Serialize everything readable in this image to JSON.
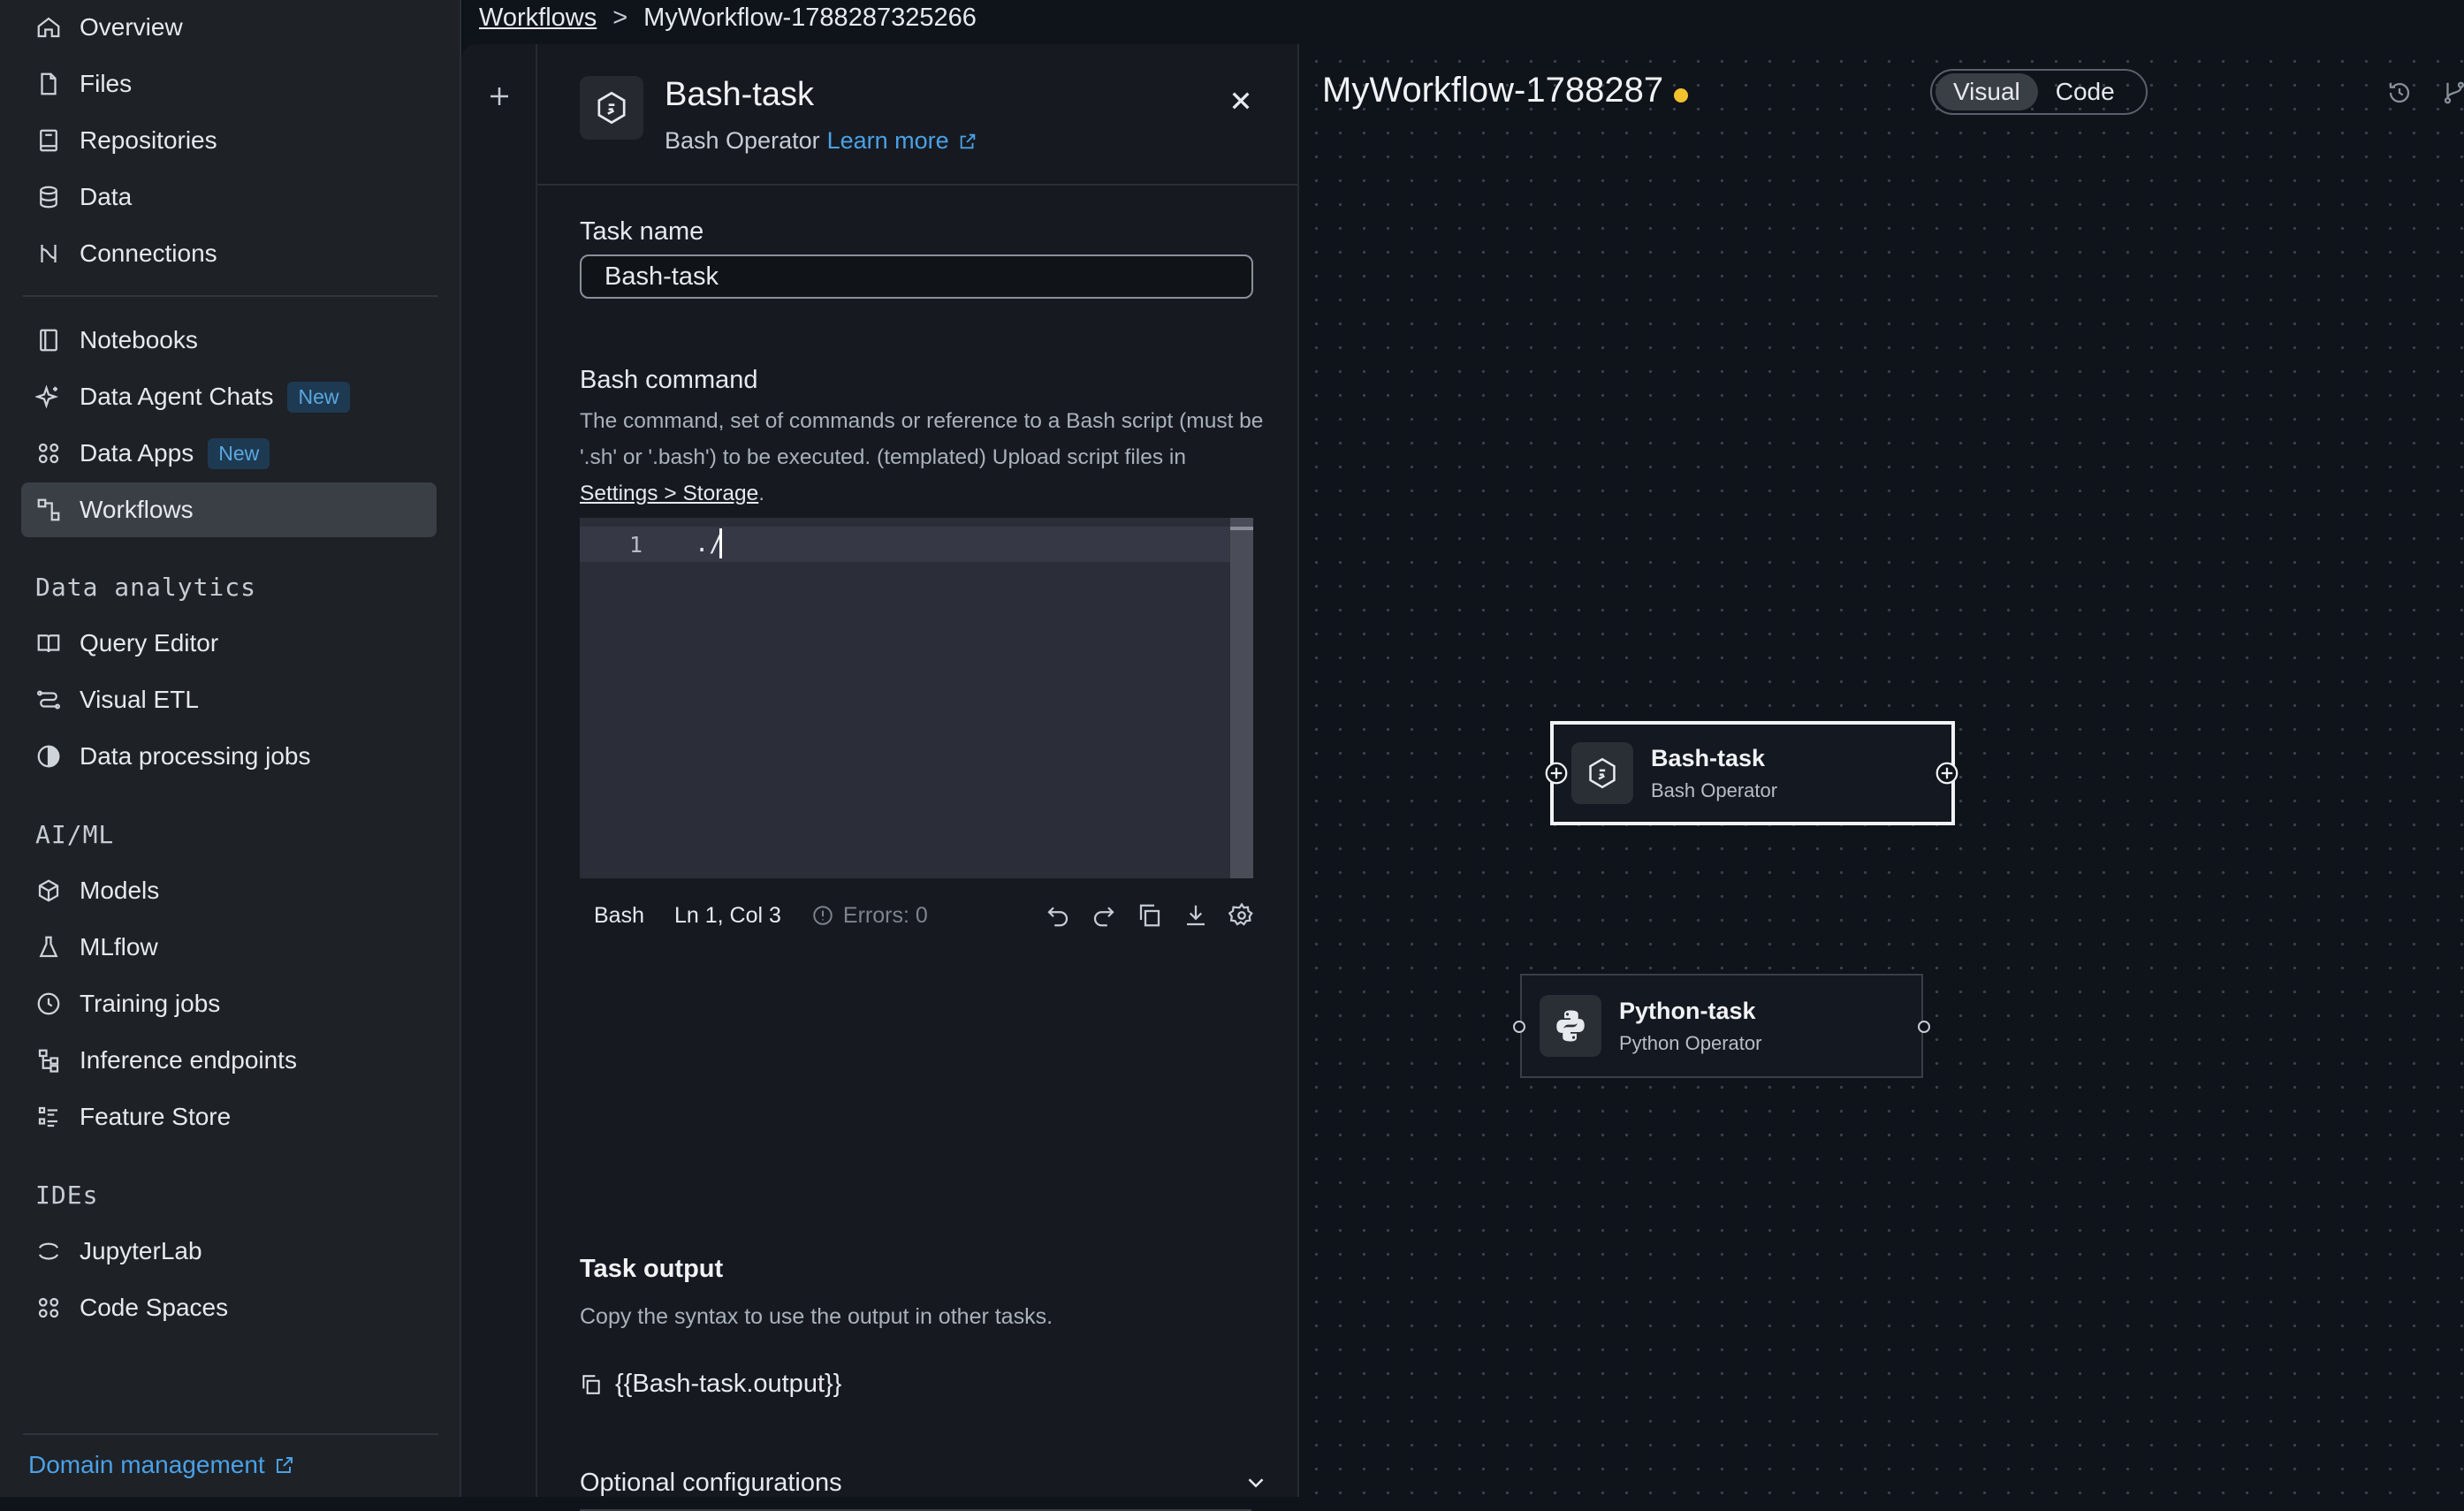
{
  "sidebar": {
    "items": [
      {
        "label": "Overview",
        "icon": "home-icon"
      },
      {
        "label": "Files",
        "icon": "file-icon"
      },
      {
        "label": "Repositories",
        "icon": "repository-icon"
      },
      {
        "label": "Data",
        "icon": "database-icon"
      },
      {
        "label": "Connections",
        "icon": "connections-icon"
      },
      {
        "label": "Notebooks",
        "icon": "notebook-icon"
      },
      {
        "label": "Data Agent Chats",
        "icon": "sparkle-icon",
        "badge": "New"
      },
      {
        "label": "Data Apps",
        "icon": "apps-grid-icon",
        "badge": "New"
      },
      {
        "label": "Workflows",
        "icon": "workflow-icon",
        "active": true
      }
    ],
    "sections": [
      {
        "title": "Data analytics",
        "items": [
          {
            "label": "Query Editor",
            "icon": "book-icon"
          },
          {
            "label": "Visual ETL",
            "icon": "etl-icon"
          },
          {
            "label": "Data processing jobs",
            "icon": "processing-icon"
          }
        ]
      },
      {
        "title": "AI/ML",
        "items": [
          {
            "label": "Models",
            "icon": "cube-icon"
          },
          {
            "label": "MLflow",
            "icon": "flask-icon"
          },
          {
            "label": "Training jobs",
            "icon": "clock-icon"
          },
          {
            "label": "Inference endpoints",
            "icon": "endpoint-icon"
          },
          {
            "label": "Feature Store",
            "icon": "list-icon"
          }
        ]
      },
      {
        "title": "IDEs",
        "items": [
          {
            "label": "JupyterLab",
            "icon": "jupyter-icon"
          },
          {
            "label": "Code Spaces",
            "icon": "apps-grid-icon"
          }
        ]
      }
    ],
    "footer_link": "Domain management"
  },
  "breadcrumb": {
    "parent": "Workflows",
    "separator": ">",
    "current": "MyWorkflow-1788287325266"
  },
  "panel": {
    "title": "Bash-task",
    "subtitle": "Bash Operator",
    "learn_more": "Learn more",
    "task_name_label": "Task name",
    "task_name_value": "Bash-task",
    "bash_label": "Bash command",
    "bash_desc": "The command, set of commands or reference to a Bash script (must be '.sh' or '.bash') to be executed. (templated) Upload script files in",
    "settings_link": "Settings > Storage",
    "editor": {
      "line_number": "1",
      "code": "./"
    },
    "status": {
      "language": "Bash",
      "position": "Ln 1, Col 3",
      "errors": "Errors: 0"
    },
    "output_title": "Task output",
    "output_desc": "Copy the syntax to use the output in other tasks.",
    "output_syntax": "{{Bash-task.output}}",
    "optional_label": "Optional configurations"
  },
  "canvas": {
    "workflow_title": "MyWorkflow-1788287",
    "unsaved_dot_color": "#f2c12e",
    "view_toggle": {
      "visual": "Visual",
      "code": "Code",
      "selected": "Visual"
    },
    "nodes": [
      {
        "name": "Bash-task",
        "type": "Bash Operator",
        "selected": true
      },
      {
        "name": "Python-task",
        "type": "Python Operator",
        "selected": false
      }
    ]
  },
  "colors": {
    "accent": "#4aa1e6",
    "badge_text": "#5aa7e0",
    "background": "#0f141b"
  }
}
